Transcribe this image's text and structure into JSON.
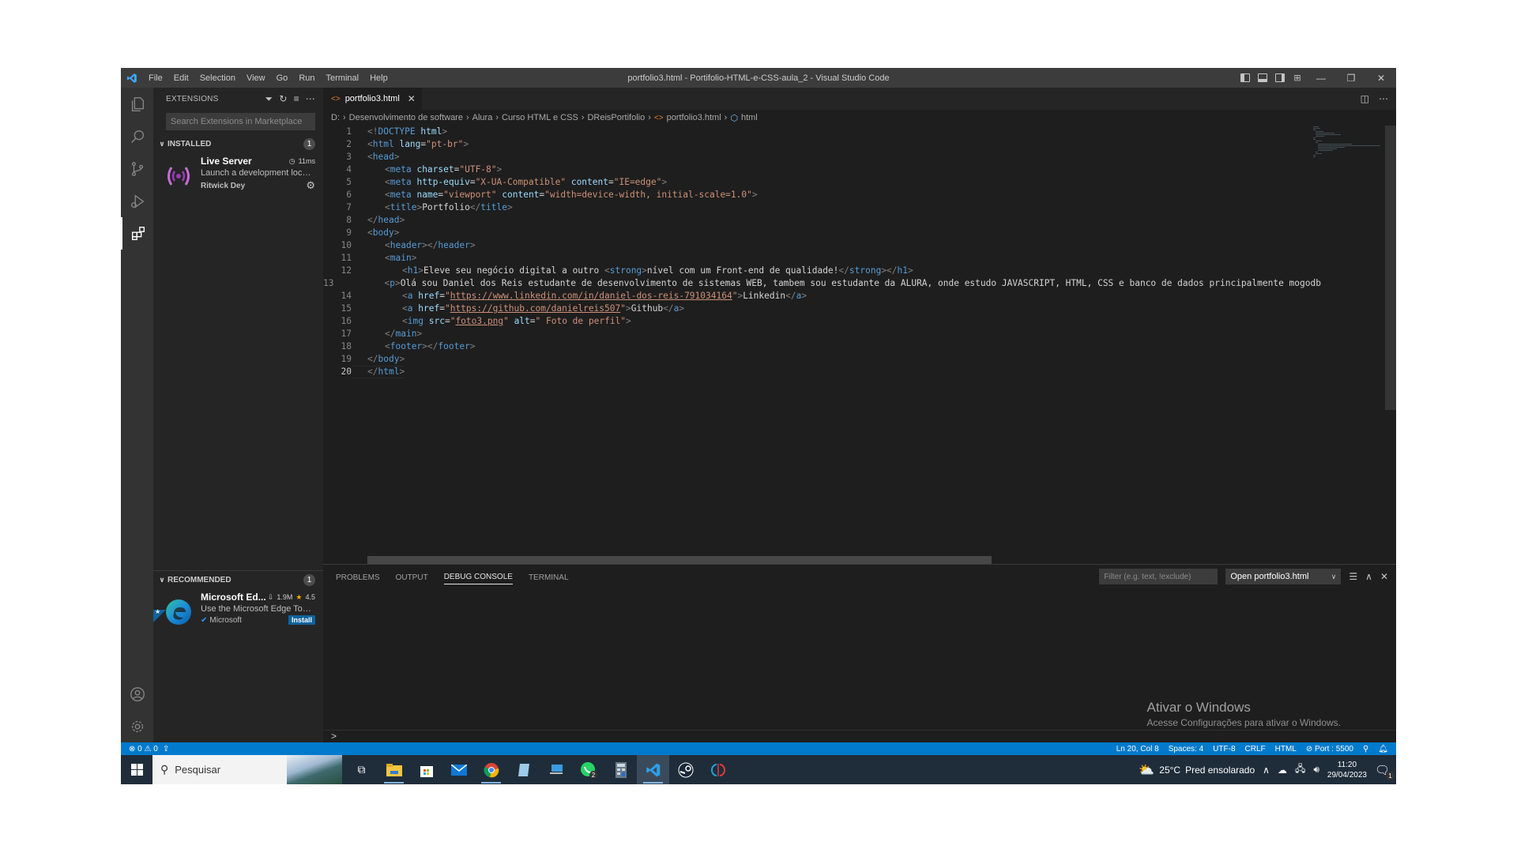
{
  "window": {
    "title": "portfolio3.html - Portifolio-HTML-e-CSS-aula_2 - Visual Studio Code",
    "menu": [
      "File",
      "Edit",
      "Selection",
      "View",
      "Go",
      "Run",
      "Terminal",
      "Help"
    ]
  },
  "sidebar": {
    "title": "EXTENSIONS",
    "search_placeholder": "Search Extensions in Marketplace",
    "installed": {
      "label": "INSTALLED",
      "count": "1",
      "items": [
        {
          "name": "Live Server",
          "time": "11ms",
          "description": "Launch a development local...",
          "publisher": "Ritwick Dey"
        }
      ]
    },
    "recommended": {
      "label": "RECOMMENDED",
      "count": "1",
      "items": [
        {
          "name": "Microsoft Ed...",
          "downloads": "1.9M",
          "rating": "4.5",
          "description": "Use the Microsoft Edge Tool...",
          "publisher": "Microsoft",
          "action": "Install"
        }
      ]
    }
  },
  "editor": {
    "tab": "portfolio3.html",
    "breadcrumb": [
      "D:",
      "Desenvolvimento de software",
      "Alura",
      "Curso HTML e CSS",
      "DReisPortifolio",
      "portfolio3.html",
      "html"
    ],
    "current_line": 20,
    "lines": [
      {
        "n": "1",
        "indent": 0,
        "tokens": [
          [
            "br",
            "<!"
          ],
          [
            "tg",
            "DOCTYPE"
          ],
          [
            "tx",
            " "
          ],
          [
            "at",
            "html"
          ],
          [
            "br",
            ">"
          ]
        ]
      },
      {
        "n": "2",
        "indent": 0,
        "tokens": [
          [
            "br",
            "<"
          ],
          [
            "tg",
            "html"
          ],
          [
            "tx",
            " "
          ],
          [
            "at",
            "lang"
          ],
          [
            "tx",
            "="
          ],
          [
            "st",
            "\"pt-br\""
          ],
          [
            "br",
            ">"
          ]
        ]
      },
      {
        "n": "3",
        "indent": 0,
        "tokens": [
          [
            "br",
            "<"
          ],
          [
            "tg",
            "head"
          ],
          [
            "br",
            ">"
          ]
        ]
      },
      {
        "n": "4",
        "indent": 1,
        "tokens": [
          [
            "br",
            "<"
          ],
          [
            "tg",
            "meta"
          ],
          [
            "tx",
            " "
          ],
          [
            "at",
            "charset"
          ],
          [
            "tx",
            "="
          ],
          [
            "st",
            "\"UTF-8\""
          ],
          [
            "br",
            ">"
          ]
        ]
      },
      {
        "n": "5",
        "indent": 1,
        "tokens": [
          [
            "br",
            "<"
          ],
          [
            "tg",
            "meta"
          ],
          [
            "tx",
            " "
          ],
          [
            "at",
            "http-equiv"
          ],
          [
            "tx",
            "="
          ],
          [
            "st",
            "\"X-UA-Compatible\""
          ],
          [
            "tx",
            " "
          ],
          [
            "at",
            "content"
          ],
          [
            "tx",
            "="
          ],
          [
            "st",
            "\"IE=edge\""
          ],
          [
            "br",
            ">"
          ]
        ]
      },
      {
        "n": "6",
        "indent": 1,
        "tokens": [
          [
            "br",
            "<"
          ],
          [
            "tg",
            "meta"
          ],
          [
            "tx",
            " "
          ],
          [
            "at",
            "name"
          ],
          [
            "tx",
            "="
          ],
          [
            "st",
            "\"viewport\""
          ],
          [
            "tx",
            " "
          ],
          [
            "at",
            "content"
          ],
          [
            "tx",
            "="
          ],
          [
            "st",
            "\"width=device-width, initial-scale=1.0\""
          ],
          [
            "br",
            ">"
          ]
        ]
      },
      {
        "n": "7",
        "indent": 1,
        "tokens": [
          [
            "br",
            "<"
          ],
          [
            "tg",
            "title"
          ],
          [
            "br",
            ">"
          ],
          [
            "tx",
            "Portfolio"
          ],
          [
            "br",
            "</"
          ],
          [
            "tg",
            "title"
          ],
          [
            "br",
            ">"
          ]
        ]
      },
      {
        "n": "8",
        "indent": 0,
        "tokens": [
          [
            "br",
            "</"
          ],
          [
            "tg",
            "head"
          ],
          [
            "br",
            ">"
          ]
        ]
      },
      {
        "n": "9",
        "indent": 0,
        "tokens": [
          [
            "br",
            "<"
          ],
          [
            "tg",
            "body"
          ],
          [
            "br",
            ">"
          ]
        ]
      },
      {
        "n": "10",
        "indent": 1,
        "tokens": [
          [
            "br",
            "<"
          ],
          [
            "tg",
            "header"
          ],
          [
            "br",
            "></"
          ],
          [
            "tg",
            "header"
          ],
          [
            "br",
            ">"
          ]
        ]
      },
      {
        "n": "11",
        "indent": 1,
        "tokens": [
          [
            "br",
            "<"
          ],
          [
            "tg",
            "main"
          ],
          [
            "br",
            ">"
          ]
        ]
      },
      {
        "n": "12",
        "indent": 2,
        "tokens": [
          [
            "br",
            "<"
          ],
          [
            "tg",
            "h1"
          ],
          [
            "br",
            ">"
          ],
          [
            "tx",
            "Eleve seu negócio digital a outro "
          ],
          [
            "br",
            "<"
          ],
          [
            "tg",
            "strong"
          ],
          [
            "br",
            ">"
          ],
          [
            "tx",
            "nível com um Front-end de qualidade!"
          ],
          [
            "br",
            "</"
          ],
          [
            "tg",
            "strong"
          ],
          [
            "br",
            "></"
          ],
          [
            "tg",
            "h1"
          ],
          [
            "br",
            ">"
          ]
        ]
      },
      {
        "n": "13",
        "indent": 2,
        "tokens": [
          [
            "br",
            "<"
          ],
          [
            "tg",
            "p"
          ],
          [
            "br",
            ">"
          ],
          [
            "tx",
            "Olá sou Daniel dos Reis estudante de desenvolvimento de sistemas WEB, tambem sou estudante da ALURA, onde estudo JAVASCRIPT, HTML, CSS e banco de dados principalmente mogodb"
          ]
        ]
      },
      {
        "n": "14",
        "indent": 2,
        "tokens": [
          [
            "br",
            "<"
          ],
          [
            "tg",
            "a"
          ],
          [
            "tx",
            " "
          ],
          [
            "at",
            "href"
          ],
          [
            "tx",
            "="
          ],
          [
            "st",
            "\""
          ],
          [
            "stu",
            "https://www.linkedin.com/in/daniel-dos-reis-791034164"
          ],
          [
            "st",
            "\""
          ],
          [
            "br",
            ">"
          ],
          [
            "tx",
            "Linkedin"
          ],
          [
            "br",
            "</"
          ],
          [
            "tg",
            "a"
          ],
          [
            "br",
            ">"
          ]
        ]
      },
      {
        "n": "15",
        "indent": 2,
        "tokens": [
          [
            "br",
            "<"
          ],
          [
            "tg",
            "a"
          ],
          [
            "tx",
            " "
          ],
          [
            "at",
            "href"
          ],
          [
            "tx",
            "="
          ],
          [
            "st",
            "\""
          ],
          [
            "stu",
            "https://github.com/danielreis507"
          ],
          [
            "st",
            "\""
          ],
          [
            "br",
            ">"
          ],
          [
            "tx",
            "Github"
          ],
          [
            "br",
            "</"
          ],
          [
            "tg",
            "a"
          ],
          [
            "br",
            ">"
          ]
        ]
      },
      {
        "n": "16",
        "indent": 2,
        "tokens": [
          [
            "br",
            "<"
          ],
          [
            "tg",
            "img"
          ],
          [
            "tx",
            " "
          ],
          [
            "at",
            "src"
          ],
          [
            "tx",
            "="
          ],
          [
            "st",
            "\""
          ],
          [
            "stu",
            "foto3.png"
          ],
          [
            "st",
            "\""
          ],
          [
            "tx",
            " "
          ],
          [
            "at",
            "alt"
          ],
          [
            "tx",
            "="
          ],
          [
            "st",
            "\" Foto de perfil\""
          ],
          [
            "br",
            ">"
          ]
        ]
      },
      {
        "n": "17",
        "indent": 1,
        "tokens": [
          [
            "br",
            "</"
          ],
          [
            "tg",
            "main"
          ],
          [
            "br",
            ">"
          ]
        ]
      },
      {
        "n": "18",
        "indent": 1,
        "tokens": [
          [
            "br",
            "<"
          ],
          [
            "tg",
            "footer"
          ],
          [
            "br",
            "></"
          ],
          [
            "tg",
            "footer"
          ],
          [
            "br",
            ">"
          ]
        ]
      },
      {
        "n": "19",
        "indent": 0,
        "tokens": [
          [
            "br",
            "</"
          ],
          [
            "tg",
            "body"
          ],
          [
            "br",
            ">"
          ]
        ]
      },
      {
        "n": "20",
        "indent": 0,
        "tokens": [
          [
            "br",
            "</"
          ],
          [
            "tg",
            "html"
          ],
          [
            "br",
            ">"
          ]
        ]
      }
    ]
  },
  "panel": {
    "tabs": [
      "PROBLEMS",
      "OUTPUT",
      "DEBUG CONSOLE",
      "TERMINAL"
    ],
    "active_tab": "DEBUG CONSOLE",
    "filter_placeholder": "Filter (e.g. text, !exclude)",
    "selected_file": "Open portfolio3.html",
    "prompt": ">"
  },
  "watermark": {
    "title": "Ativar o Windows",
    "subtitle": "Acesse Configurações para ativar o Windows."
  },
  "statusbar": {
    "errors": "0",
    "warnings": "0",
    "position": "Ln 20, Col 8",
    "spaces": "Spaces: 4",
    "encoding": "UTF-8",
    "eol": "CRLF",
    "language": "HTML",
    "port": "Port : 5500"
  },
  "taskbar": {
    "search_placeholder": "Pesquisar",
    "apps": [
      "task-view",
      "file-explorer",
      "microsoft-store",
      "mail",
      "chrome",
      "notepad",
      "remote-desktop",
      "whatsapp",
      "calculator",
      "vscode",
      "steam",
      "app"
    ],
    "whatsapp_badge": "2",
    "weather_temp": "25°C",
    "weather_text": "Pred ensolarado",
    "time": "11:20",
    "date": "29/04/2023",
    "notifications": "1"
  }
}
